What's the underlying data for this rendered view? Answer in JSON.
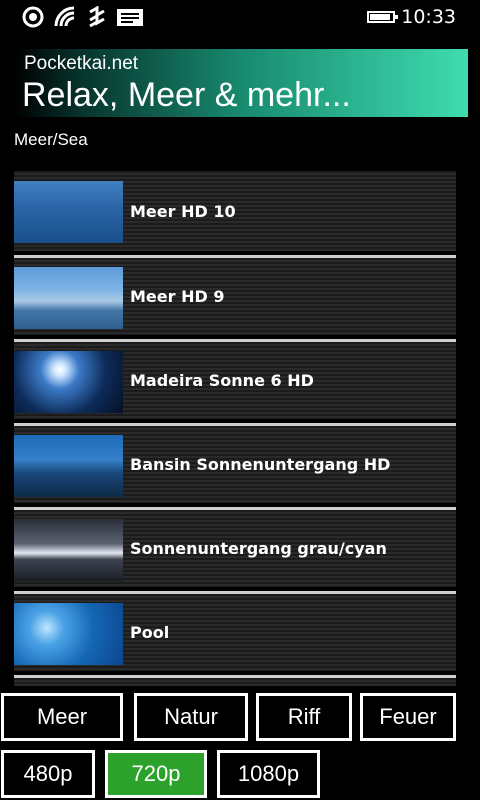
{
  "status_bar": {
    "time": "10:33",
    "icons": [
      "sync-icon",
      "signal-icon",
      "data-icon",
      "message-icon",
      "battery-icon"
    ]
  },
  "banner": {
    "site": "Pocketkai.net",
    "title": "Relax, Meer & mehr..."
  },
  "category_label": "Meer/Sea",
  "videos": [
    {
      "title": "Meer HD 10"
    },
    {
      "title": "Meer HD 9"
    },
    {
      "title": "Madeira Sonne 6 HD"
    },
    {
      "title": "Bansin Sonnenuntergang HD"
    },
    {
      "title": "Sonnenuntergang grau/cyan"
    },
    {
      "title": "Pool"
    },
    {
      "title": ""
    }
  ],
  "category_buttons": [
    "Meer",
    "Natur",
    "Riff",
    "Feuer"
  ],
  "quality_buttons": [
    "480p",
    "720p",
    "1080p"
  ],
  "selected_quality": "720p",
  "colors": {
    "accent": "#2ca12c",
    "banner_gradient_end": "#3fdcb0"
  }
}
